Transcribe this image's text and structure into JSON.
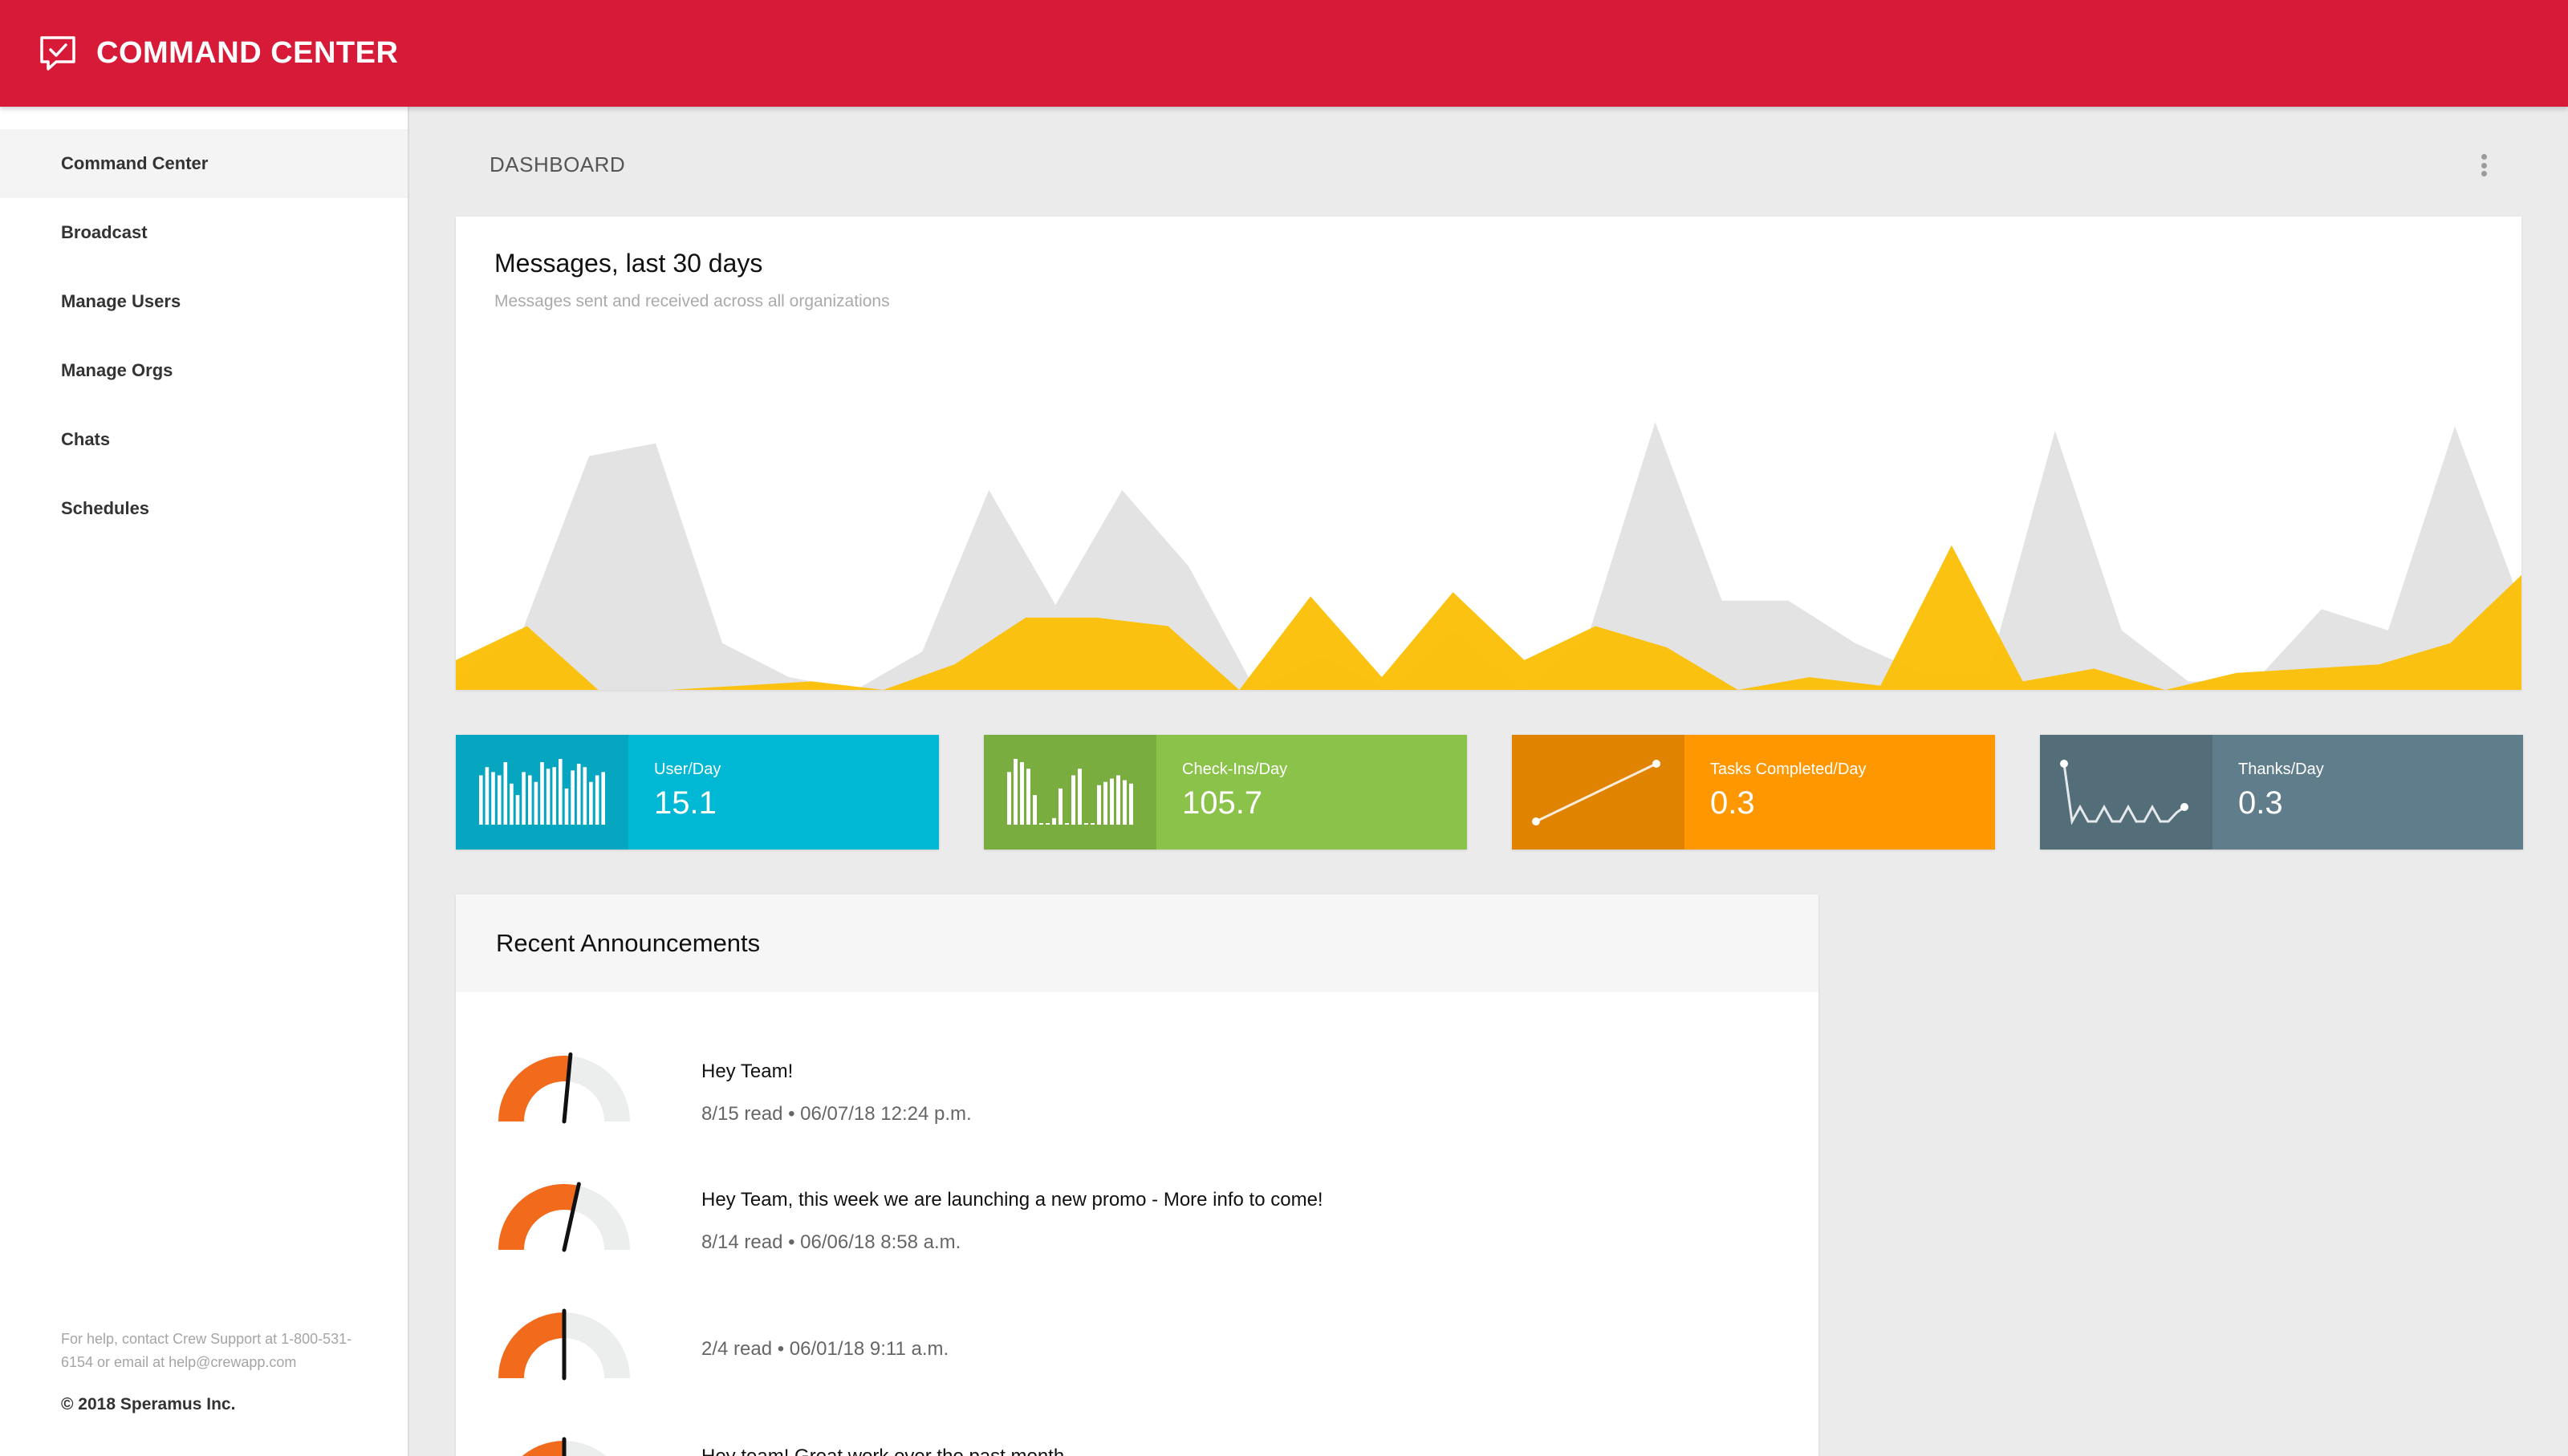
{
  "app": {
    "title": "COMMAND CENTER",
    "logo_icon": "chat-check-icon"
  },
  "sidebar": {
    "items": [
      {
        "label": "Command Center",
        "active": true
      },
      {
        "label": "Broadcast",
        "active": false
      },
      {
        "label": "Manage Users",
        "active": false
      },
      {
        "label": "Manage Orgs",
        "active": false
      },
      {
        "label": "Chats",
        "active": false
      },
      {
        "label": "Schedules",
        "active": false
      }
    ],
    "help": "For help, contact Crew Support at 1-800-531-6154 or email at help@crewapp.com",
    "copyright": "© 2018 Speramus Inc."
  },
  "main": {
    "heading": "DASHBOARD",
    "menu_icon": "more-vert-icon"
  },
  "chart_data": {
    "type": "area",
    "title": "Messages, last 30 days",
    "subtitle": "Messages sent and received across all organizations",
    "xlabel": "",
    "ylabel": "",
    "ylim": [
      0,
      100
    ],
    "grid": false,
    "series": [
      {
        "color": "#e3e3e3",
        "values": [
          3,
          14,
          55,
          58,
          11,
          3,
          0,
          9,
          47,
          20,
          47,
          29,
          0,
          8,
          0,
          14,
          0,
          13,
          63,
          21,
          21,
          11,
          4,
          4,
          61,
          14,
          2,
          2,
          19,
          14,
          62,
          20
        ]
      },
      {
        "color": "#fcbf07",
        "values": [
          7,
          15,
          0,
          0,
          1,
          2,
          0,
          6,
          17,
          17,
          15,
          0,
          22,
          3,
          23,
          7,
          15,
          10,
          0,
          3,
          1,
          34,
          2,
          5,
          0,
          4,
          5,
          6,
          11,
          27
        ]
      }
    ]
  },
  "stats": [
    {
      "label": "User/Day",
      "value": "15.1",
      "icon": "bar-sparkline-icon",
      "color": "#00b8d4",
      "icon_bg": "#06a5c0",
      "spark": [
        30,
        35,
        32,
        30,
        38,
        25,
        18,
        32,
        30,
        26,
        38,
        34,
        35,
        40,
        22,
        33,
        37,
        35,
        26,
        30,
        32
      ]
    },
    {
      "label": "Check-Ins/Day",
      "value": "105.7",
      "icon": "bar-sparkline-icon",
      "color": "#8bc34a",
      "icon_bg": "#7aad3f",
      "spark": [
        32,
        40,
        38,
        34,
        18,
        0,
        0,
        4,
        22,
        0,
        30,
        34,
        0,
        0,
        24,
        26,
        28,
        30,
        27,
        25
      ]
    },
    {
      "label": "Tasks Completed/Day",
      "value": "0.3",
      "icon": "line-sparkline-icon",
      "color": "#ff9800",
      "icon_bg": "#e08300",
      "spark": [
        0,
        3,
        6,
        9,
        12,
        15,
        18,
        21,
        24,
        27
      ]
    },
    {
      "label": "Thanks/Day",
      "value": "0.3",
      "icon": "line-sparkline-icon",
      "color": "#607d8b",
      "icon_bg": "#536d79",
      "spark": [
        40,
        0,
        10,
        0,
        0,
        10,
        0,
        0,
        10,
        0,
        0,
        10,
        0,
        0,
        6,
        10
      ]
    }
  ],
  "announcements": {
    "title": "Recent Announcements",
    "items": [
      {
        "title": "Hey Team!",
        "meta": "8/15 read • 06/07/18 12:24 p.m.",
        "read_fraction": 0.53,
        "icon": "gauge-icon"
      },
      {
        "title": "Hey Team, this week we are launching a new promo - More info to come!",
        "meta": "8/14 read • 06/06/18 8:58 a.m.",
        "read_fraction": 0.57,
        "icon": "gauge-icon"
      },
      {
        "title": "",
        "meta": "2/4 read • 06/01/18 9:11 a.m.",
        "read_fraction": 0.5,
        "icon": "gauge-icon"
      },
      {
        "title": "Hey team! Great work over the past month",
        "meta": "",
        "read_fraction": 0.5,
        "icon": "gauge-icon"
      }
    ]
  }
}
